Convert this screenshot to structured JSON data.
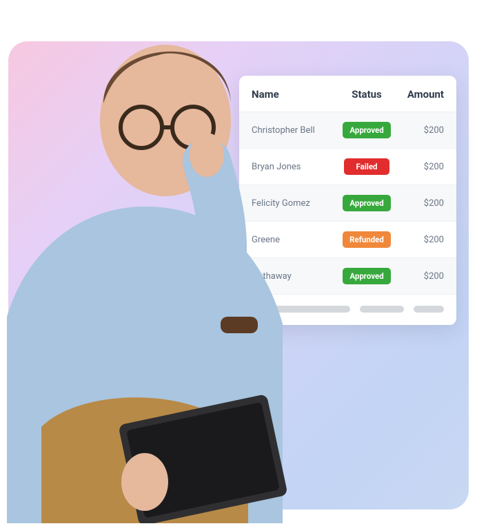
{
  "table": {
    "headers": {
      "name": "Name",
      "status": "Status",
      "amount": "Amount"
    },
    "rows": [
      {
        "name": "Christopher Bell",
        "status": "Approved",
        "status_kind": "approved",
        "amount": "$200"
      },
      {
        "name": "Bryan Jones",
        "status": "Failed",
        "status_kind": "failed",
        "amount": "$200"
      },
      {
        "name": "Felicity Gomez",
        "status": "Approved",
        "status_kind": "approved",
        "amount": "$200"
      },
      {
        "name": "Greene",
        "status": "Refunded",
        "status_kind": "refunded",
        "amount": "$200"
      },
      {
        "name": "Hathaway",
        "status": "Approved",
        "status_kind": "approved",
        "amount": "$200"
      }
    ]
  },
  "colors": {
    "approved": "#37a93c",
    "failed": "#e12d2d",
    "refunded": "#f0883b"
  }
}
